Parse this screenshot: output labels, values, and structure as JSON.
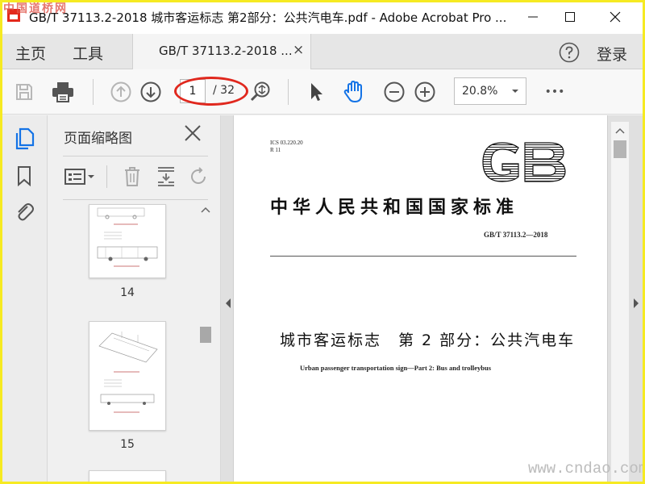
{
  "titlebar": {
    "title": "GB/T 37113.2-2018 城市客运标志 第2部分：公共汽电车.pdf - Adobe Acrobat Pro ..."
  },
  "menu": {
    "home": "主页",
    "tools": "工具",
    "tab_label": "GB/T 37113.2-2018 ...",
    "tab_close": "×",
    "login": "登录"
  },
  "toolbar": {
    "page_current": "1",
    "page_total": "/ 32",
    "zoom": "20.8%",
    "more": "•••"
  },
  "thumbnails": {
    "panel_title": "页面缩略图",
    "pages": [
      {
        "label": "14"
      },
      {
        "label": "15"
      }
    ]
  },
  "document": {
    "ics": "ICS  03.220.20",
    "classification": "R  11",
    "logo_text": "GB",
    "standard_title": "中华人民共和国国家标准",
    "standard_number": "GB/T  37113.2—2018",
    "title_cn": "城市客运标志　第 2 部分：公共汽电车",
    "title_en": "Urban passenger transportation sign—Part 2: Bus and trolleybus"
  },
  "watermarks": {
    "top_left": "中国道桥网",
    "bottom_right": "www.cndao.com"
  },
  "colors": {
    "highlight": "#e0281e",
    "hand_tool": "#1473e6",
    "frame": "#f6ea22"
  }
}
